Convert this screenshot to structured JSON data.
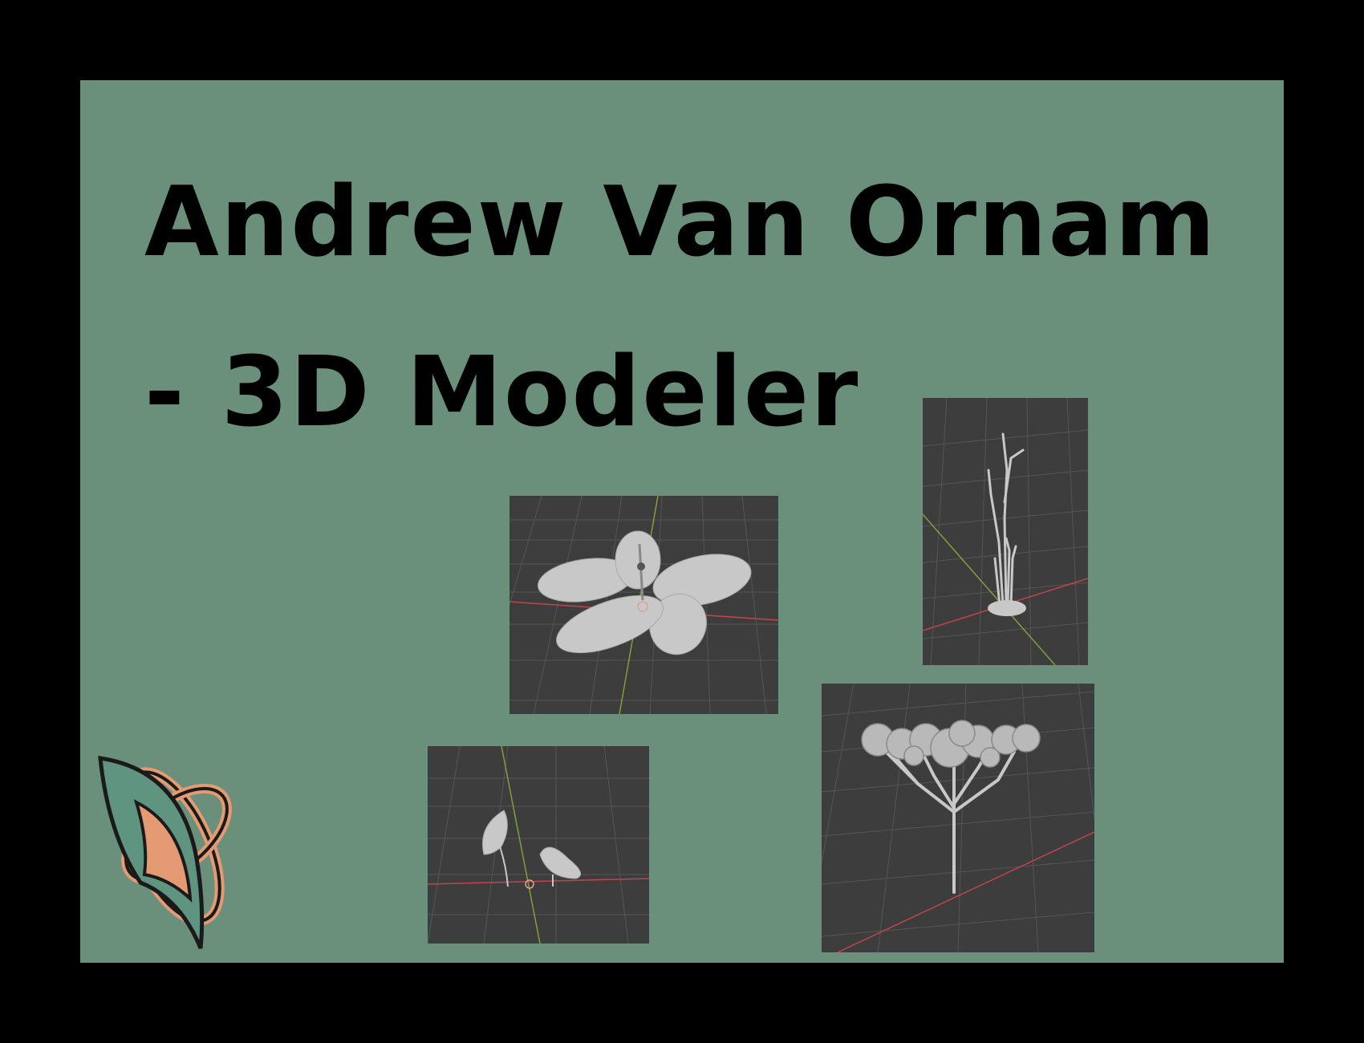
{
  "title": {
    "line1": "Andrew Van Ornam",
    "line2": "- 3D Modeler"
  },
  "colors": {
    "frame": "#000000",
    "panel": "#6a8f7a",
    "viewport": "#3d3d3d",
    "grid": "#555555",
    "axis_x": "#c0454a",
    "axis_y": "#7fa13a",
    "model": "#c8c8c8",
    "logo_teal": "#5f9480",
    "logo_orange": "#e49a72"
  },
  "images": [
    {
      "name": "flower-model-render",
      "subject": "flower"
    },
    {
      "name": "twig-plant-model-render",
      "subject": "twigs"
    },
    {
      "name": "leaf-pair-model-render",
      "subject": "leaves"
    },
    {
      "name": "tree-model-render",
      "subject": "tree"
    }
  ],
  "logo": {
    "icon": "leaf-orbit-logo"
  }
}
